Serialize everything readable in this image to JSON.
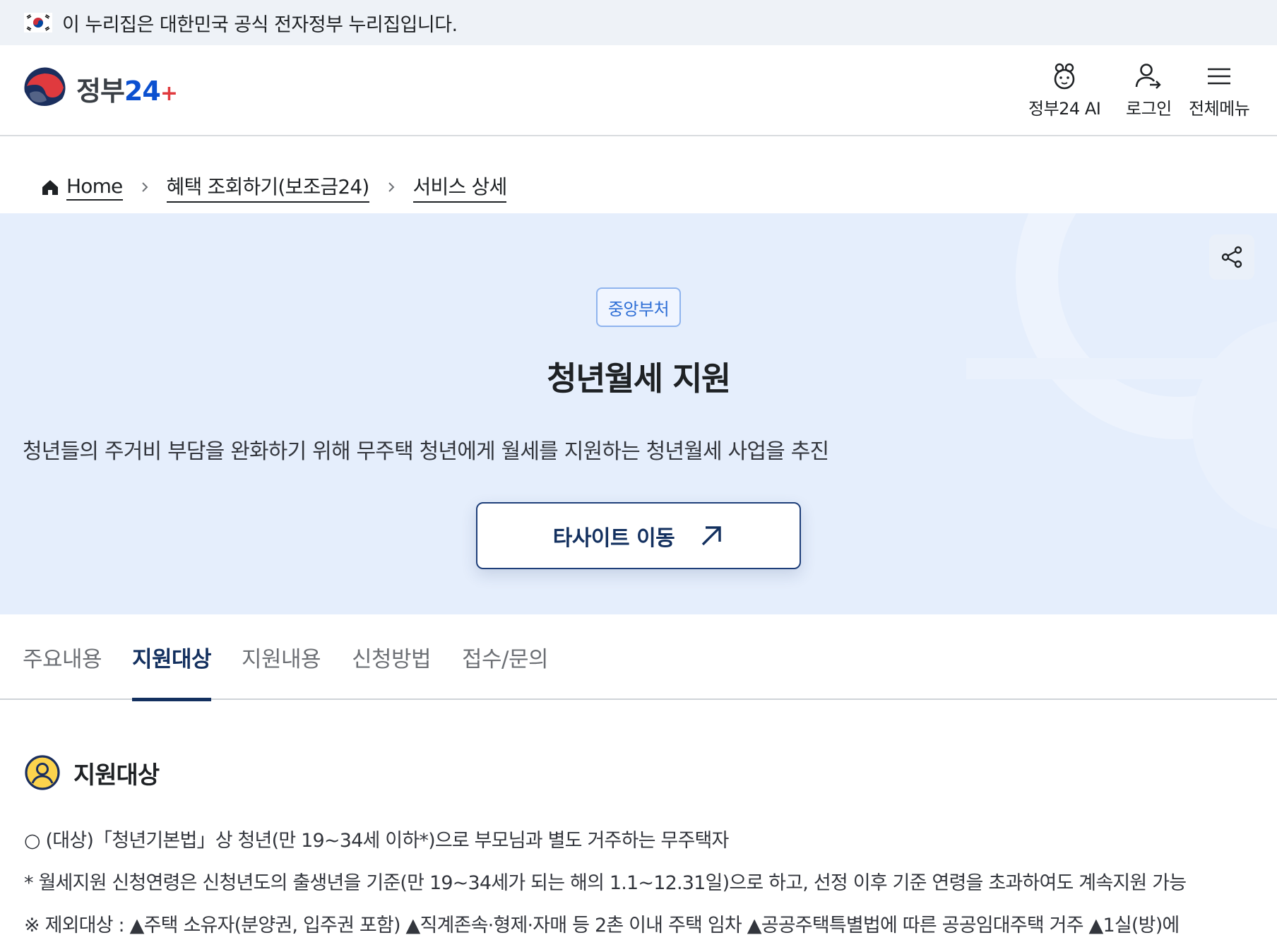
{
  "gov_banner": {
    "text": "이 누리집은 대한민국 공식 전자정부 누리집입니다."
  },
  "header": {
    "logo": {
      "text_ko": "정부",
      "text_num": "24"
    },
    "utils": [
      {
        "label": "정부24 AI",
        "icon": "ai-mascot-icon"
      },
      {
        "label": "로그인",
        "icon": "user-login-icon"
      },
      {
        "label": "전체메뉴",
        "icon": "hamburger-menu-icon"
      }
    ]
  },
  "breadcrumb": {
    "home": "Home",
    "items": [
      "혜택 조회하기(보조금24)",
      "서비스 상세"
    ]
  },
  "hero": {
    "badge": "중앙부처",
    "title": "청년월세 지원",
    "description": "청년들의 주거비 부담을 완화하기 위해 무주택 청년에게 월세를 지원하는 청년월세 사업을 추진",
    "button_label": "타사이트 이동"
  },
  "tabs": [
    {
      "label": "주요내용",
      "active": false
    },
    {
      "label": "지원대상",
      "active": true
    },
    {
      "label": "지원내용",
      "active": false
    },
    {
      "label": "신청방법",
      "active": false
    },
    {
      "label": "접수/문의",
      "active": false
    }
  ],
  "section": {
    "title": "지원대상",
    "lines": [
      "○ (대상)「청년기본법」상 청년(만 19~34세 이하*)으로 부모님과 별도 거주하는 무주택자",
      "* 월세지원 신청연령은 신청년도의 출생년을 기준(만 19~34세가 되는 해의 1.1~12.31일)으로 하고, 선정 이후 기준 연령을 초과하여도 계속지원 가능",
      "※ 제외대상 : ▲주택 소유자(분양권, 입주권 포함) ▲직계존속·형제·자매 등 2촌 이내 주택 임차 ▲공공주택특별법에 따른 공공임대주택 거주 ▲1실(방)에"
    ]
  },
  "colors": {
    "hero_bg": "#e5eefc",
    "navy": "#13305f",
    "badge_blue": "#2f6fd6",
    "banner_bg": "#eef2f7"
  }
}
